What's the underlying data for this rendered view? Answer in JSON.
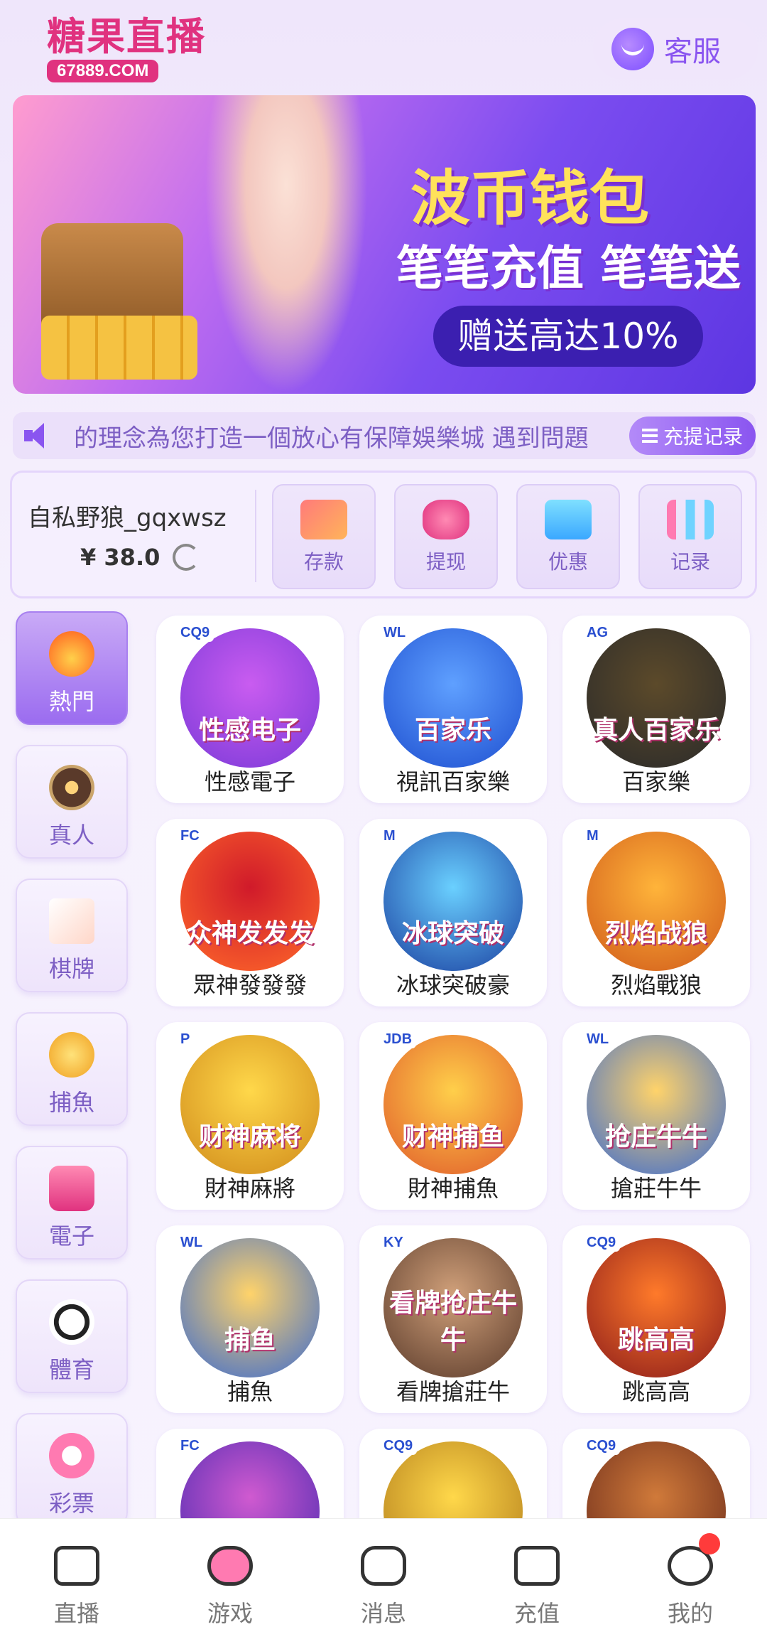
{
  "header": {
    "logo_text": "糖果直播",
    "logo_domain": "67889.COM",
    "service_label": "客服"
  },
  "banner": {
    "title": "波币钱包",
    "subtitle": "笔笔充值 笔笔送",
    "pill": "赠送高达10%",
    "active_dot": 1,
    "dots": 4
  },
  "marquee": {
    "text": "的理念為您打造一個放心有保障娛樂城   遇到問題",
    "record_button": "充提记录"
  },
  "account": {
    "username": "自私野狼_gqxwsz",
    "balance": "¥ 38.0",
    "actions": [
      {
        "label": "存款",
        "icon": "card-icon"
      },
      {
        "label": "提现",
        "icon": "money-bag-icon"
      },
      {
        "label": "优惠",
        "icon": "gift-icon"
      },
      {
        "label": "记录",
        "icon": "bar-chart-icon"
      }
    ]
  },
  "categories": [
    {
      "label": "熱門",
      "icon": "fire-icon",
      "active": true
    },
    {
      "label": "真人",
      "icon": "chip-icon",
      "active": false
    },
    {
      "label": "棋牌",
      "icon": "poker-card-icon",
      "active": false
    },
    {
      "label": "捕魚",
      "icon": "fish-icon",
      "active": false
    },
    {
      "label": "電子",
      "icon": "slot-machine-icon",
      "active": false
    },
    {
      "label": "體育",
      "icon": "soccer-ball-icon",
      "active": false
    },
    {
      "label": "彩票",
      "icon": "lottery-ball-icon",
      "active": false
    }
  ],
  "games": [
    {
      "label": "性感電子",
      "tag": "CQ9",
      "art": "性感电子"
    },
    {
      "label": "視訊百家樂",
      "tag": "WL",
      "art": "百家乐"
    },
    {
      "label": "百家樂",
      "tag": "AG",
      "art": "真人百家乐"
    },
    {
      "label": "眾神發發發",
      "tag": "FC",
      "art": "众神发发发"
    },
    {
      "label": "冰球突破豪",
      "tag": "M",
      "art": "冰球突破"
    },
    {
      "label": "烈焰戰狼",
      "tag": "M",
      "art": "烈焰战狼"
    },
    {
      "label": "財神麻將",
      "tag": "P",
      "art": "财神麻将"
    },
    {
      "label": "財神捕魚",
      "tag": "JDB",
      "art": "财神捕鱼"
    },
    {
      "label": "搶莊牛牛",
      "tag": "WL",
      "art": "抢庄牛牛"
    },
    {
      "label": "捕魚",
      "tag": "WL",
      "art": "捕鱼"
    },
    {
      "label": "看牌搶莊牛",
      "tag": "KY",
      "art": "看牌抢庄牛牛"
    },
    {
      "label": "跳高高",
      "tag": "CQ9",
      "art": "跳高高"
    },
    {
      "label": "",
      "tag": "FC",
      "art": ""
    },
    {
      "label": "",
      "tag": "CQ9",
      "art": ""
    },
    {
      "label": "",
      "tag": "CQ9",
      "art": ""
    }
  ],
  "tabbar": [
    {
      "label": "直播",
      "icon": "camera-icon"
    },
    {
      "label": "游戏",
      "icon": "gamepad-icon"
    },
    {
      "label": "消息",
      "icon": "chat-icon"
    },
    {
      "label": "充值",
      "icon": "wallet-icon"
    },
    {
      "label": "我的",
      "icon": "profile-icon",
      "badge": true
    }
  ],
  "colors": {
    "accent": "#8a55f0",
    "brand": "#e0327f",
    "background": "#f5effe"
  }
}
